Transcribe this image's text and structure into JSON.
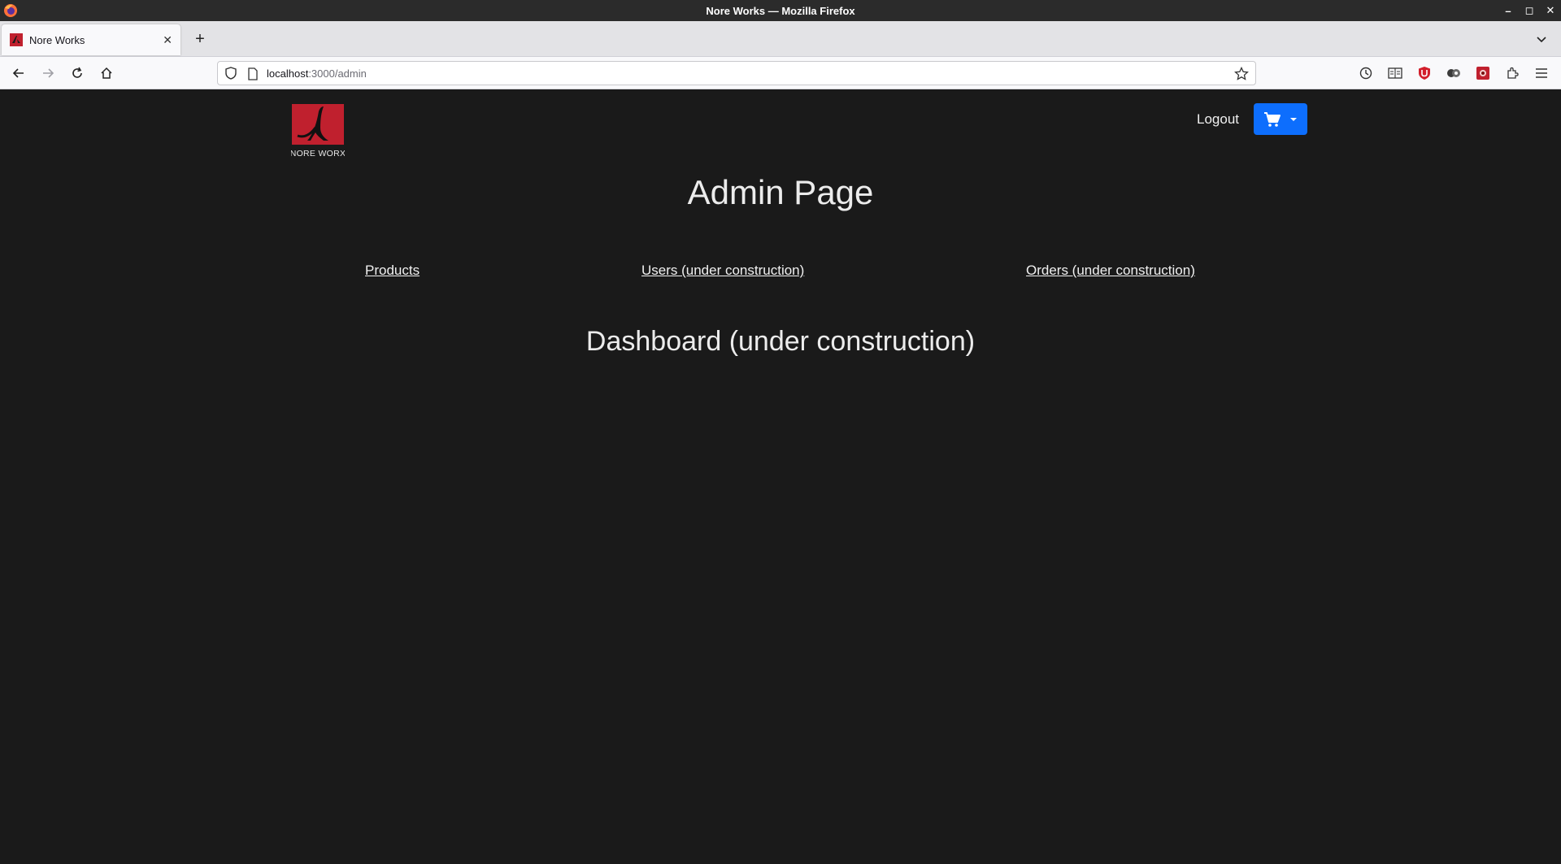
{
  "window": {
    "title": "Nore Works — Mozilla Firefox"
  },
  "browser": {
    "tab": {
      "title": "Nore Works"
    },
    "url": {
      "host": "localhost",
      "path": ":3000/admin"
    }
  },
  "header": {
    "logo_text": "NORE WORX",
    "logout_label": "Logout",
    "cart_color": "#0d6efd"
  },
  "main": {
    "title": "Admin Page",
    "nav": [
      {
        "label": "Products"
      },
      {
        "label": "Users (under construction)"
      },
      {
        "label": "Orders (under construction)"
      }
    ],
    "dashboard_title": "Dashboard (under construction)"
  },
  "colors": {
    "page_bg": "#1a1a1a",
    "logo_red": "#c0202e",
    "accent_blue": "#0d6efd"
  }
}
